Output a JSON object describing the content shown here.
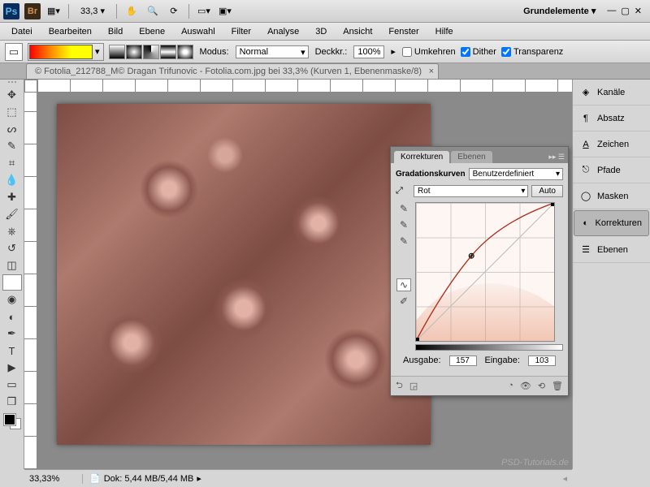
{
  "appbar": {
    "zoom": "33,3",
    "workspace": "Grundelemente"
  },
  "menu": [
    "Datei",
    "Bearbeiten",
    "Bild",
    "Ebene",
    "Auswahl",
    "Filter",
    "Analyse",
    "3D",
    "Ansicht",
    "Fenster",
    "Hilfe"
  ],
  "options": {
    "mode_label": "Modus:",
    "mode_value": "Normal",
    "opacity_label": "Deckkr.:",
    "opacity_value": "100%",
    "reverse": "Umkehren",
    "dither": "Dither",
    "transparency": "Transparenz"
  },
  "doc_tab": "© Fotolia_212788_M© Dragan Trifunovic - Fotolia.com.jpg bei 33,3% (Kurven 1, Ebenenmaske/8)",
  "right_panels": [
    "Kanäle",
    "Absatz",
    "Zeichen",
    "Pfade",
    "Masken",
    "Korrekturen",
    "Ebenen"
  ],
  "curves_panel": {
    "tab1": "Korrekturen",
    "tab2": "Ebenen",
    "title": "Gradationskurven",
    "preset": "Benutzerdefiniert",
    "channel": "Rot",
    "auto": "Auto",
    "output_label": "Ausgabe:",
    "output_value": "157",
    "input_label": "Eingabe:",
    "input_value": "103"
  },
  "status": {
    "zoom": "33,33%",
    "doc": "Dok: 5,44 MB/5,44 MB"
  },
  "watermark": "PSD-Tutorials.de",
  "chart_data": {
    "type": "line",
    "title": "Gradationskurven (Curves) — Rot channel",
    "xlabel": "Eingabe",
    "ylabel": "Ausgabe",
    "xlim": [
      0,
      255
    ],
    "ylim": [
      0,
      255
    ],
    "series": [
      {
        "name": "Baseline",
        "x": [
          0,
          255
        ],
        "y": [
          0,
          255
        ]
      },
      {
        "name": "Red curve",
        "x": [
          0,
          51,
          103,
          179,
          255
        ],
        "y": [
          0,
          95,
          157,
          221,
          255
        ]
      }
    ],
    "selected_point": {
      "input": 103,
      "output": 157
    }
  }
}
